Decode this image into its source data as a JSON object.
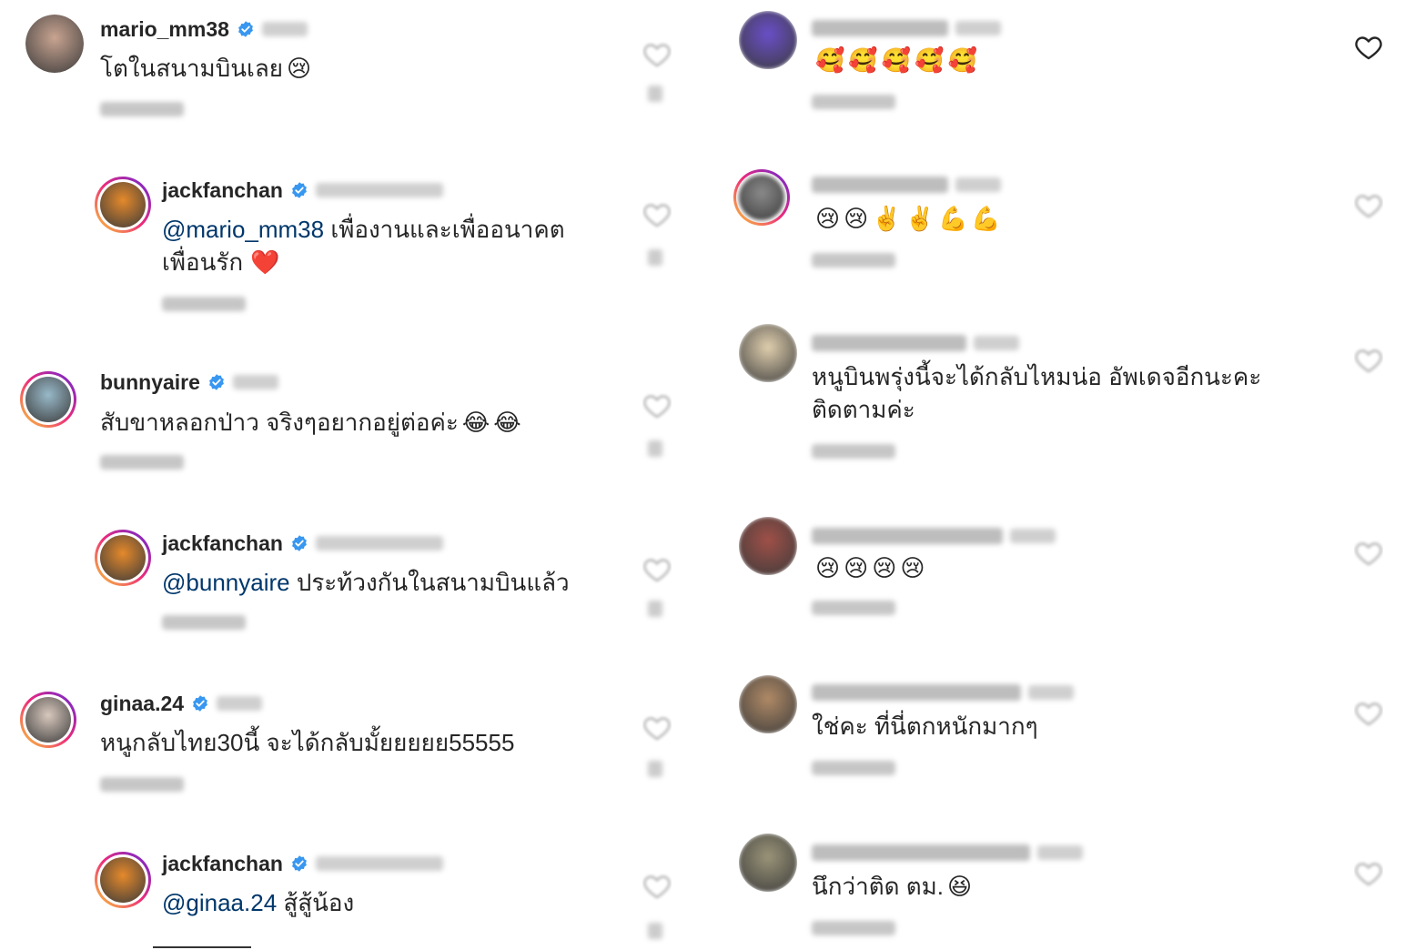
{
  "colors": {
    "mention": "#00376b",
    "text": "#262626",
    "verified": "#3897f0",
    "like_outline": "#262626"
  },
  "left_column": [
    {
      "username": "mario_mm38",
      "verified": true,
      "text_parts": [
        {
          "t": "โตในสนามบินเลย"
        }
      ],
      "emojis": [
        "😢"
      ]
    },
    {
      "username": "jackfanchan",
      "verified": true,
      "reply": true,
      "text_parts": [
        {
          "t": "@mario_mm38",
          "mention": true
        },
        {
          "t": " เพื่องานและเพื่ออนาคต"
        }
      ],
      "text_line2": "เพื่อนรัก",
      "emojis": [
        "❤️"
      ]
    },
    {
      "username": "bunnyaire",
      "verified": true,
      "text_parts": [
        {
          "t": "สับขาหลอกป่าว จริงๆอยากอยู่ต่อค่ะ"
        }
      ],
      "emojis": [
        "😂",
        "😂"
      ]
    },
    {
      "username": "jackfanchan",
      "verified": true,
      "reply": true,
      "text_parts": [
        {
          "t": "@bunnyaire",
          "mention": true
        },
        {
          "t": " ประท้วงกันในสนามบินแล้ว"
        }
      ],
      "emojis": []
    },
    {
      "username": "ginaa.24",
      "verified": true,
      "text_parts": [
        {
          "t": "หนูกลับไทย30นี้ จะได้กลับมั้ยยยยย55555"
        }
      ],
      "emojis": []
    },
    {
      "username": "jackfanchan",
      "verified": true,
      "reply": true,
      "text_parts": [
        {
          "t": "@ginaa.24",
          "mention": true
        },
        {
          "t": " สู้สู้น้อง"
        }
      ],
      "emojis": []
    }
  ],
  "right_column": [
    {
      "username": "",
      "text_parts": [],
      "emojis": [
        "🥰",
        "🥰",
        "🥰",
        "🥰",
        "🥰"
      ]
    },
    {
      "username": "",
      "text_parts": [],
      "emojis": [
        "😢",
        "😢",
        "✌️",
        "✌️",
        "💪",
        "💪"
      ]
    },
    {
      "username": "",
      "text_parts": [
        {
          "t": "หนูบินพรุ่งนี้จะได้กลับไหมน่อ อัพเดจอีกนะคะ"
        }
      ],
      "text_line2": "ติดตามค่ะ",
      "emojis": []
    },
    {
      "username": "",
      "text_parts": [],
      "emojis": [
        "😢",
        "😢",
        "😢",
        "😢"
      ]
    },
    {
      "username": "",
      "text_parts": [
        {
          "t": "ใช่คะ ที่นี่ตกหนักมากๆ"
        }
      ],
      "emojis": []
    },
    {
      "username": "",
      "text_parts": [
        {
          "t": "นึกว่าติด ตม."
        }
      ],
      "emojis": [
        "😆"
      ]
    }
  ],
  "icons": {
    "like": "heart-outline-icon",
    "verified": "verified-badge-icon"
  }
}
